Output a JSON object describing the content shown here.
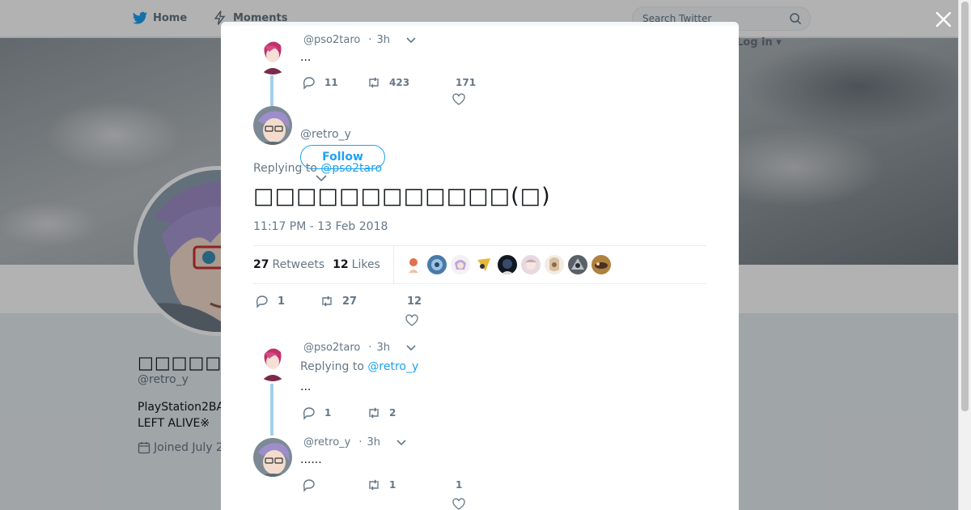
{
  "nav": {
    "home_label": "Home",
    "moments_label": "Moments",
    "search_placeholder": "Search Twitter",
    "login_label": "Log in"
  },
  "profile": {
    "name": "□□□□□□□□□",
    "handle": "@retro_y",
    "bio_line1": "PlayStation2BA",
    "bio_line2": "LEFT ALIVE※",
    "joined": "Joined July 2"
  },
  "thread": {
    "tweet1": {
      "handle": "@pso2taro",
      "time": "3h",
      "text": "...",
      "replies": "11",
      "retweets": "423",
      "likes": "171"
    },
    "main": {
      "handle": "@retro_y",
      "follow_label": "Follow",
      "replying_prefix": "Replying to",
      "replying_to": "@pso2taro",
      "text": "□□□□□□□□□□□□(□)",
      "timestamp": "11:17 PM - 13 Feb 2018",
      "retweets_count": "27",
      "retweets_label": "Retweets",
      "likes_count": "12",
      "likes_label": "Likes",
      "replies": "1",
      "retweets": "27",
      "likes": "12"
    },
    "reply1": {
      "handle": "@pso2taro",
      "time": "3h",
      "replying_prefix": "Replying to",
      "replying_to": "@retro_y",
      "text": "...",
      "replies": "1",
      "retweets": "2"
    },
    "reply2": {
      "handle": "@retro_y",
      "time": "3h",
      "text": "......",
      "replies": "",
      "retweets": "1",
      "likes": "1"
    }
  },
  "colors": {
    "accent": "#1da1f2",
    "thread_line": "#a5d0ef",
    "muted_text": "#657786"
  }
}
